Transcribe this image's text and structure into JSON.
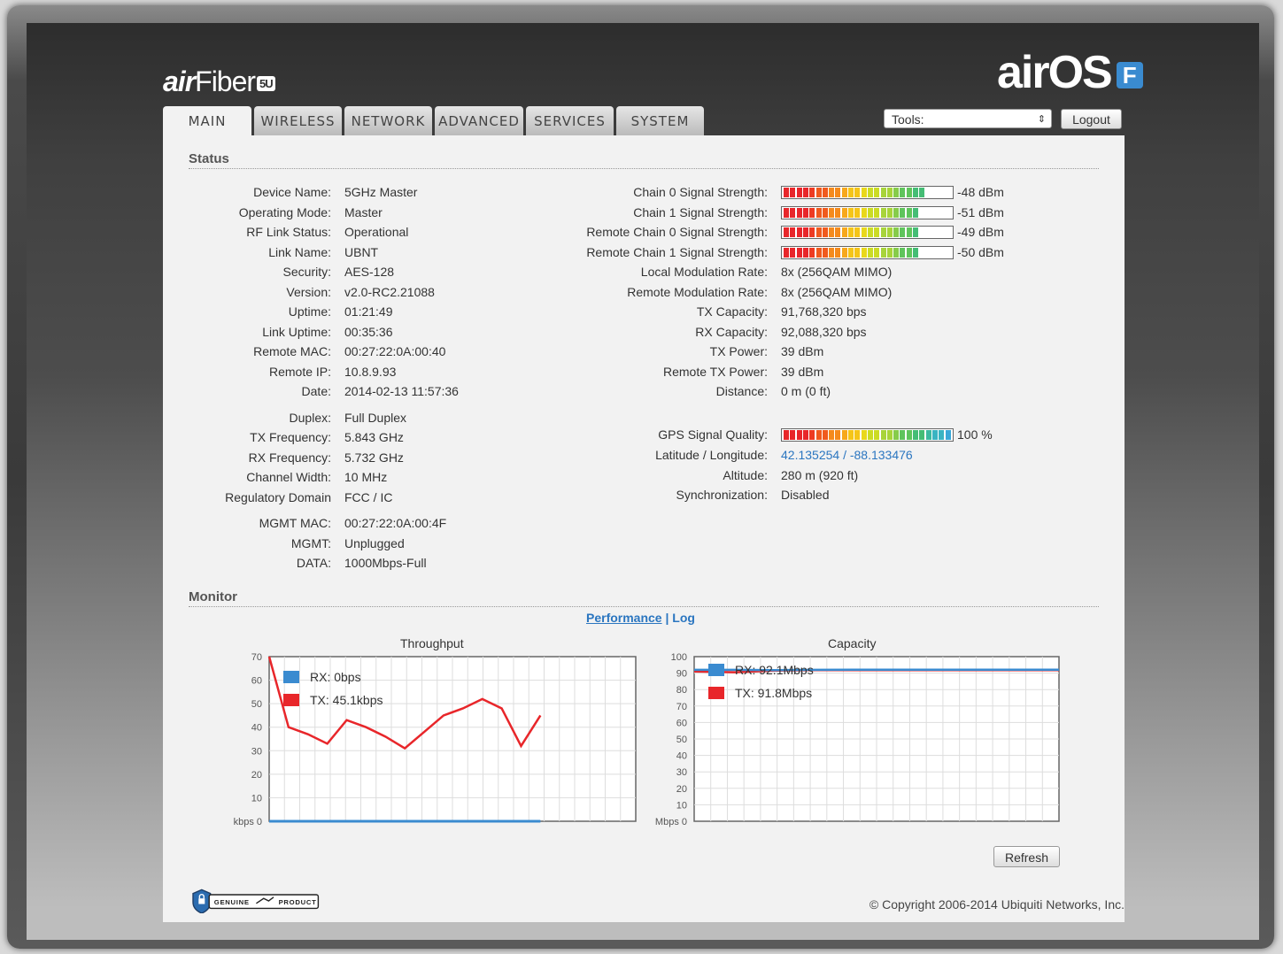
{
  "brand": {
    "left_logo_ai": "air",
    "left_logo_rest": "Fiber",
    "left_logo_badge": "5U",
    "right_logo": "airOS",
    "right_logo_badge": "F"
  },
  "tabs": [
    {
      "label": "MAIN",
      "active": true
    },
    {
      "label": "WIRELESS"
    },
    {
      "label": "NETWORK"
    },
    {
      "label": "ADVANCED"
    },
    {
      "label": "SERVICES"
    },
    {
      "label": "SYSTEM"
    }
  ],
  "tools": {
    "label": "Tools:",
    "arrow": "⇕"
  },
  "logout_label": "Logout",
  "status": {
    "title": "Status",
    "left": [
      {
        "label": "Device Name:",
        "value": "5GHz Master"
      },
      {
        "label": "Operating Mode:",
        "value": "Master"
      },
      {
        "label": "RF Link Status:",
        "value": "Operational"
      },
      {
        "label": "Link Name:",
        "value": "UBNT"
      },
      {
        "label": "Security:",
        "value": "AES-128"
      },
      {
        "label": "Version:",
        "value": "v2.0-RC2.21088"
      },
      {
        "label": "Uptime:",
        "value": "01:21:49"
      },
      {
        "label": "Link Uptime:",
        "value": "00:35:36"
      },
      {
        "label": "Remote MAC:",
        "value": "00:27:22:0A:00:40"
      },
      {
        "label": "Remote IP:",
        "value": "10.8.9.93"
      },
      {
        "label": "Date:",
        "value": "2014-02-13 11:57:36"
      },
      {
        "label": "Duplex:",
        "value": "Full Duplex"
      },
      {
        "label": "TX Frequency:",
        "value": "5.843 GHz"
      },
      {
        "label": "RX Frequency:",
        "value": "5.732 GHz"
      },
      {
        "label": "Channel Width:",
        "value": "10 MHz"
      },
      {
        "label": "Regulatory Domain",
        "value": "FCC / IC"
      },
      {
        "label": "MGMT MAC:",
        "value": "00:27:22:0A:00:4F"
      },
      {
        "label": "MGMT:",
        "value": "Unplugged"
      },
      {
        "label": "DATA:",
        "value": "1000Mbps-Full"
      }
    ],
    "right": [
      {
        "label": "Chain 0 Signal Strength:",
        "value": "-48 dBm",
        "level": 0.84
      },
      {
        "label": "Chain 1 Signal Strength:",
        "value": "-51 dBm",
        "level": 0.79
      },
      {
        "label": "Remote Chain 0 Signal Strength:",
        "value": "-49 dBm",
        "level": 0.82
      },
      {
        "label": "Remote Chain 1 Signal Strength:",
        "value": "-50 dBm",
        "level": 0.8
      },
      {
        "label": "Local Modulation Rate:",
        "value": "8x (256QAM MIMO)"
      },
      {
        "label": "Remote Modulation Rate:",
        "value": "8x (256QAM MIMO)"
      },
      {
        "label": "TX Capacity:",
        "value": "91,768,320 bps"
      },
      {
        "label": "RX Capacity:",
        "value": "92,088,320 bps"
      },
      {
        "label": "TX Power:",
        "value": "39 dBm"
      },
      {
        "label": "Remote TX Power:",
        "value": "39 dBm"
      },
      {
        "label": "Distance:",
        "value": "0 m (0 ft)"
      },
      {
        "label": "GPS Signal Quality:",
        "value": "100 %",
        "level": 1.0
      },
      {
        "label": "Latitude / Longitude:",
        "value": "42.135254 / -88.133476",
        "link": true
      },
      {
        "label": "Altitude:",
        "value": "280 m (920 ft)"
      },
      {
        "label": "Synchronization:",
        "value": "Disabled"
      }
    ]
  },
  "monitor": {
    "title": "Monitor",
    "link_performance": "Performance",
    "separator": "|",
    "link_log": "Log",
    "refresh_label": "Refresh"
  },
  "colors": {
    "rx": "#3a8bd0",
    "tx": "#e8262a"
  },
  "chart_data": [
    {
      "type": "line",
      "title": "Throughput",
      "ylabel": "kbps",
      "ylim": [
        0,
        70
      ],
      "yticks": [
        0,
        10,
        20,
        30,
        40,
        50,
        60,
        70
      ],
      "series": [
        {
          "name": "RX: 0bps",
          "values": [
            0,
            0,
            0,
            0,
            0,
            0,
            0,
            0,
            0,
            0,
            0,
            0,
            0,
            0,
            0
          ]
        },
        {
          "name": "TX: 45.1kbps",
          "values": [
            70,
            40,
            37,
            33,
            43,
            40,
            36,
            31,
            38,
            45,
            48,
            52,
            48,
            32,
            45
          ]
        }
      ]
    },
    {
      "type": "line",
      "title": "Capacity",
      "ylabel": "Mbps",
      "ylim": [
        0,
        100
      ],
      "yticks": [
        0,
        10,
        20,
        30,
        40,
        50,
        60,
        70,
        80,
        90,
        100
      ],
      "series": [
        {
          "name": "RX: 92.1Mbps",
          "values": [
            92,
            92,
            91.8,
            92,
            92.1,
            92.1,
            92.1,
            92.1,
            92.1,
            92.1
          ]
        },
        {
          "name": "TX: 91.8Mbps",
          "values": [
            91,
            90.5,
            91.5,
            91.8,
            91.8,
            91.8,
            91.8,
            91.8,
            91.8,
            91.8
          ]
        }
      ]
    }
  ],
  "footer": {
    "genuine_left": "GENUINE",
    "genuine_right": "PRODUCT",
    "copyright": "© Copyright 2006-2014 Ubiquiti Networks, Inc."
  }
}
